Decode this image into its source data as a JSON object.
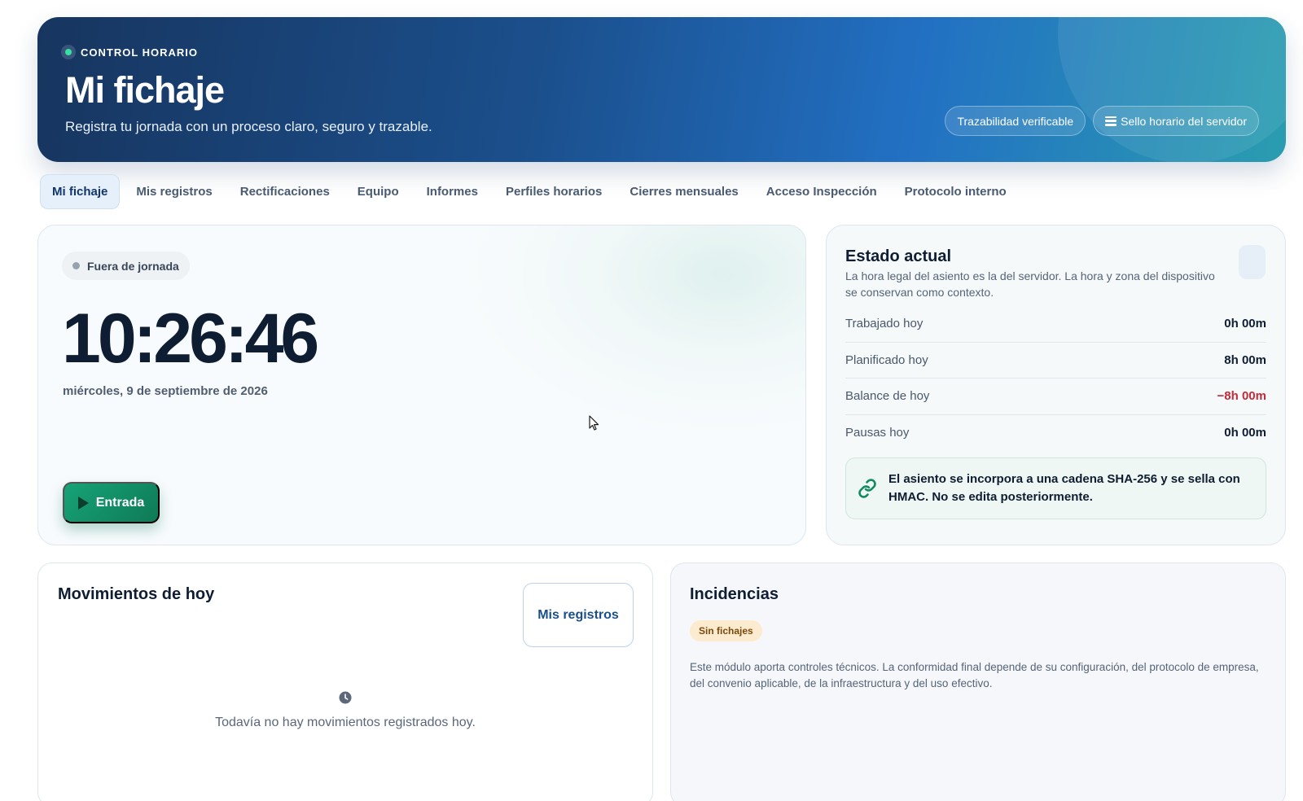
{
  "hero": {
    "eyebrow": "CONTROL HORARIO",
    "title": "Mi fichaje",
    "subtitle": "Registra tu jornada con un proceso claro, seguro y trazable.",
    "chips": [
      {
        "label": "Trazabilidad verificable"
      },
      {
        "label": "Sello horario del servidor",
        "icon": "list-icon"
      }
    ]
  },
  "nav": {
    "tabs": [
      {
        "label": "Mi fichaje",
        "active": true
      },
      {
        "label": "Mis registros"
      },
      {
        "label": "Rectificaciones"
      },
      {
        "label": "Equipo"
      },
      {
        "label": "Informes"
      },
      {
        "label": "Perfiles horarios"
      },
      {
        "label": "Cierres mensuales"
      },
      {
        "label": "Acceso Inspección"
      },
      {
        "label": "Protocolo interno"
      }
    ]
  },
  "clock": {
    "status": "Fuera de jornada",
    "time": "10:26:46",
    "date": "miércoles, 9 de septiembre de 2026",
    "entry_button": "Entrada"
  },
  "state": {
    "title": "Estado actual",
    "description": "La hora legal del asiento es la del servidor. La hora y zona del dispositivo se conservan como contexto.",
    "metrics": [
      {
        "label": "Trabajado hoy",
        "value": "0h 00m"
      },
      {
        "label": "Planificado hoy",
        "value": "8h 00m"
      },
      {
        "label": "Balance de hoy",
        "value": "−8h 00m",
        "negative": true
      },
      {
        "label": "Pausas hoy",
        "value": "0h 00m"
      }
    ],
    "hash_note": "El asiento se incorpora a una cadena SHA-256 y se sella con HMAC. No se edita posteriormente."
  },
  "movements": {
    "title": "Movimientos de hoy",
    "button": "Mis registros",
    "empty": "Todavía no hay movimientos registrados hoy."
  },
  "incidents": {
    "title": "Incidencias",
    "badge": "Sin fichajes",
    "text": "Este módulo aporta controles técnicos. La conformidad final depende de su configuración, del protocolo de empresa, del convenio aplicable, de la infraestructura y del uso efectivo."
  },
  "colors": {
    "brand_dark": "#17355f",
    "brand_teal": "#2a9db0",
    "success": "#0e7a56",
    "negative": "#c42a3a",
    "badge_warning_bg": "#fdebcf"
  }
}
